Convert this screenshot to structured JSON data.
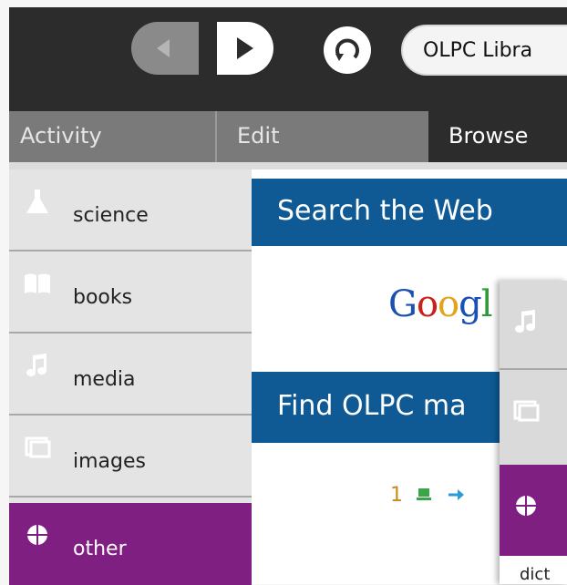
{
  "toolbar": {
    "url": "OLPC Libra"
  },
  "tabs": [
    {
      "label": "Activity"
    },
    {
      "label": "Edit"
    },
    {
      "label": "Browse"
    }
  ],
  "sidebar": {
    "items": [
      {
        "label": "science",
        "icon": "flask-icon"
      },
      {
        "label": "books",
        "icon": "book-icon"
      },
      {
        "label": "media",
        "icon": "music-note-icon"
      },
      {
        "label": "images",
        "icon": "images-icon"
      },
      {
        "label": "other",
        "icon": "globe-icon"
      }
    ]
  },
  "content": {
    "search_heading": "Search the Web",
    "google_logo": "Googl",
    "find_heading": "Find OLPC ma",
    "pager_number": "1"
  },
  "overlay": {
    "cut_text": "dict"
  },
  "colors": {
    "toolbar_bg": "#2c2c2c",
    "tabbar_bg": "#7a7a7a",
    "heading_blue": "#0f5a94",
    "selected_purple": "#7f1f82",
    "sidebar_bg": "#e4e4e4"
  }
}
